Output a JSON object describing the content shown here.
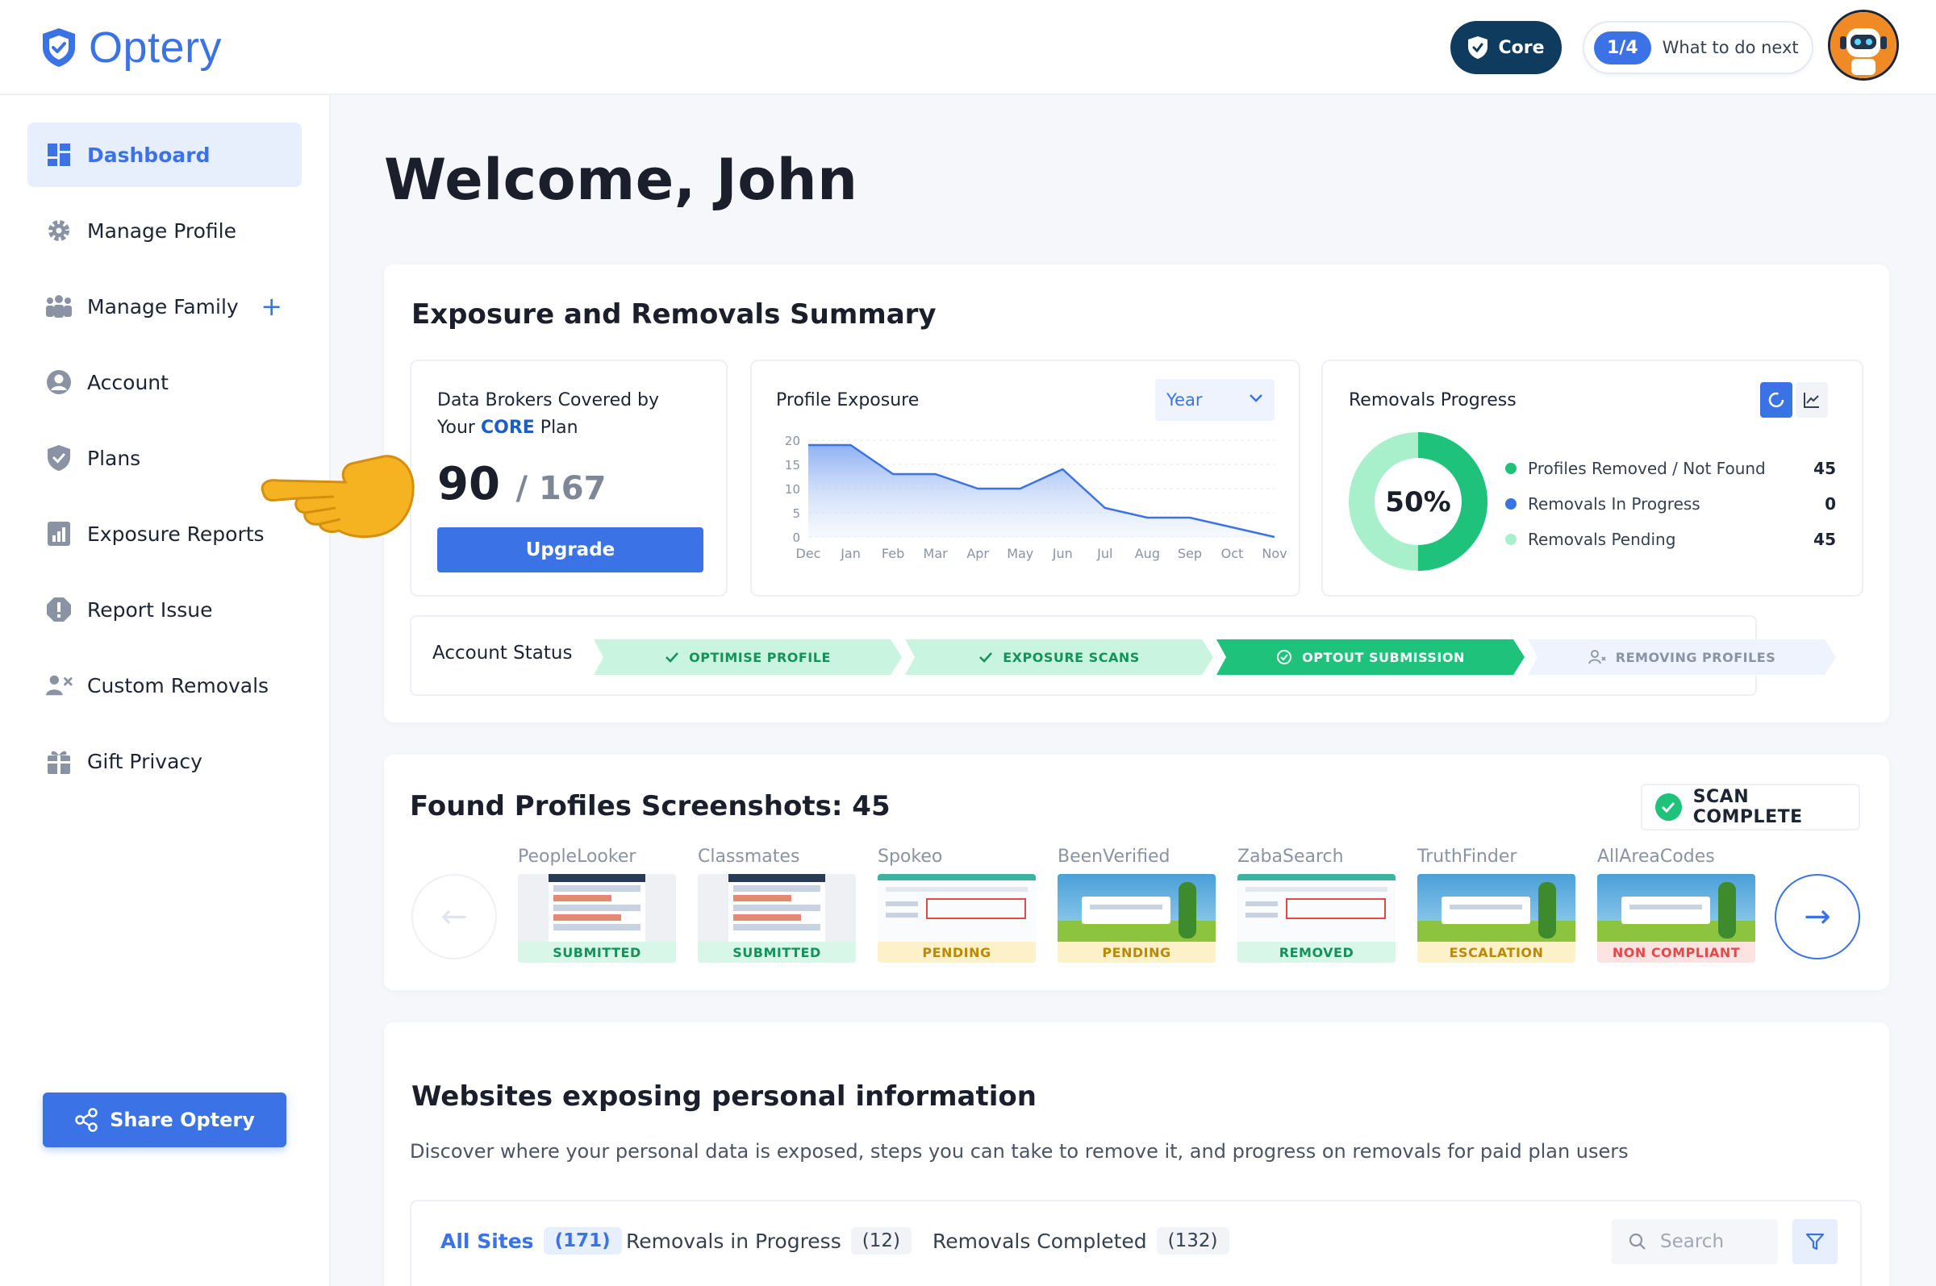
{
  "header": {
    "brand": "Optery",
    "plan_badge": "Core",
    "next_step_count": "1/4",
    "next_step_label": "What to do next"
  },
  "sidebar": {
    "items": [
      {
        "label": "Dashboard",
        "icon": "dashboard-icon"
      },
      {
        "label": "Manage Profile",
        "icon": "gear-icon"
      },
      {
        "label": "Manage Family",
        "icon": "family-icon"
      },
      {
        "label": "Account",
        "icon": "user-circle-icon"
      },
      {
        "label": "Plans",
        "icon": "shield-check-icon"
      },
      {
        "label": "Exposure Reports",
        "icon": "report-chart-icon"
      },
      {
        "label": "Report Issue",
        "icon": "alert-icon"
      },
      {
        "label": "Custom Removals",
        "icon": "user-remove-icon"
      },
      {
        "label": "Gift Privacy",
        "icon": "gift-icon"
      }
    ],
    "share_label": "Share Optery"
  },
  "welcome": "Welcome, John",
  "summary": {
    "title": "Exposure and Removals Summary",
    "brokers": {
      "label_line1": "Data Brokers Covered  by",
      "label_line2_prefix": "Your",
      "label_line2_plan": "CORE",
      "label_line2_suffix": "Plan",
      "covered": "90",
      "total": "/ 167",
      "upgrade_label": "Upgrade"
    },
    "exposure": {
      "title": "Profile Exposure",
      "range_select": "Year"
    },
    "removals": {
      "title": "Removals Progress",
      "percent": "50%",
      "legend": [
        {
          "label": "Profiles Removed / Not Found",
          "value": "45",
          "color": "#1fc27a"
        },
        {
          "label": "Removals In Progress",
          "value": "0",
          "color": "#3b73e6"
        },
        {
          "label": "Removals Pending",
          "value": "45",
          "color": "#a8f0cc"
        }
      ],
      "fraction_removed": 0.5
    },
    "account_status": {
      "label": "Account Status",
      "steps": [
        {
          "label": "OPTIMISE PROFILE",
          "state": "done"
        },
        {
          "label": "EXPOSURE SCANS",
          "state": "done"
        },
        {
          "label": "OPTOUT SUBMISSION",
          "state": "current"
        },
        {
          "label": "REMOVING PROFILES",
          "state": "todo"
        }
      ]
    }
  },
  "chart_data": {
    "type": "area",
    "title": "Profile Exposure",
    "categories": [
      "Dec",
      "Jan",
      "Feb",
      "Mar",
      "Apr",
      "May",
      "Jun",
      "Jul",
      "Aug",
      "Sep",
      "Oct",
      "Nov"
    ],
    "values": [
      19,
      19,
      13,
      13,
      10,
      10,
      14,
      6,
      4,
      4,
      2,
      0
    ],
    "yticks": [
      "20",
      "15",
      "10",
      "5",
      "0"
    ],
    "ylim": [
      0,
      20
    ],
    "grid": true
  },
  "found_profiles": {
    "title": "Found Profiles Screenshots: 45",
    "scan_status": "SCAN COMPLETE",
    "thumbs": [
      {
        "name": "PeopleLooker",
        "status": "SUBMITTED"
      },
      {
        "name": "Classmates",
        "status": "SUBMITTED"
      },
      {
        "name": "Spokeo",
        "status": "PENDING"
      },
      {
        "name": "BeenVerified",
        "status": "PENDING"
      },
      {
        "name": "ZabaSearch",
        "status": "REMOVED"
      },
      {
        "name": "TruthFinder",
        "status": "ESCALATION"
      },
      {
        "name": "AllAreaCodes",
        "status": "NON COMPLIANT"
      }
    ],
    "prev_arrow": "←",
    "next_arrow": "→"
  },
  "websites": {
    "title": "Websites exposing personal information",
    "description": "Discover where your personal data is exposed, steps you can take to remove it, and progress on removals for paid plan users",
    "tabs": [
      {
        "label": "All Sites",
        "count": "(171)"
      },
      {
        "label": "Removals in Progress",
        "count": "(12)"
      },
      {
        "label": "Removals Completed",
        "count": "(132)"
      }
    ],
    "search_placeholder": "Search"
  }
}
